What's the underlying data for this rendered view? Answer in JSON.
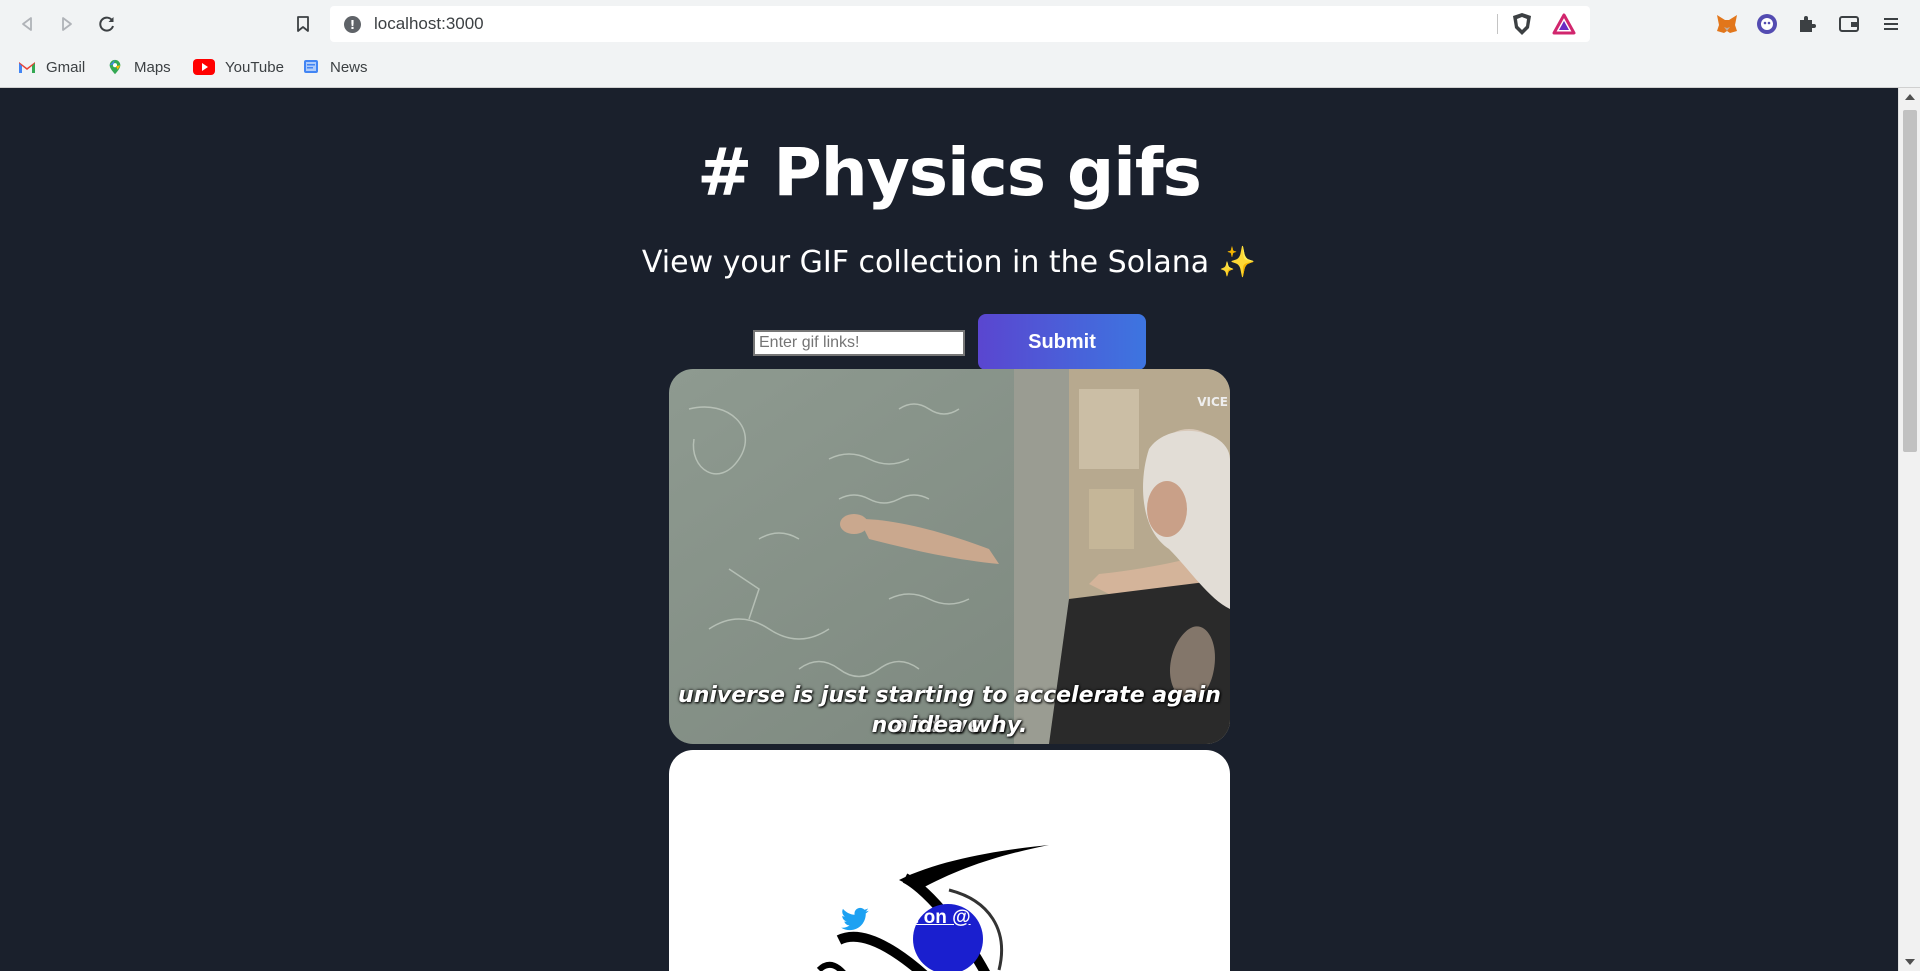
{
  "browser": {
    "url": "localhost:3000",
    "bookmarks": [
      {
        "label": "Gmail",
        "icon": "gmail-icon"
      },
      {
        "label": "Maps",
        "icon": "maps-icon"
      },
      {
        "label": "YouTube",
        "icon": "youtube-icon"
      },
      {
        "label": "News",
        "icon": "news-icon"
      }
    ]
  },
  "page": {
    "title": "# Physics gifs",
    "subtitle": "View your GIF collection in the Solana ✨",
    "input_placeholder": "Enter gif links!",
    "input_value": "",
    "submit_label": "Submit"
  },
  "gifs": [
    {
      "watermark": "VICE",
      "caption_line1": "universe is just starting to accelerate again and we h",
      "caption_line2": "no idea why."
    },
    {
      "overlay_text": "t on @"
    }
  ],
  "colors": {
    "background": "#1a202c",
    "accent_gradient_start": "#5a46d0",
    "accent_gradient_end": "#3d75e0"
  }
}
